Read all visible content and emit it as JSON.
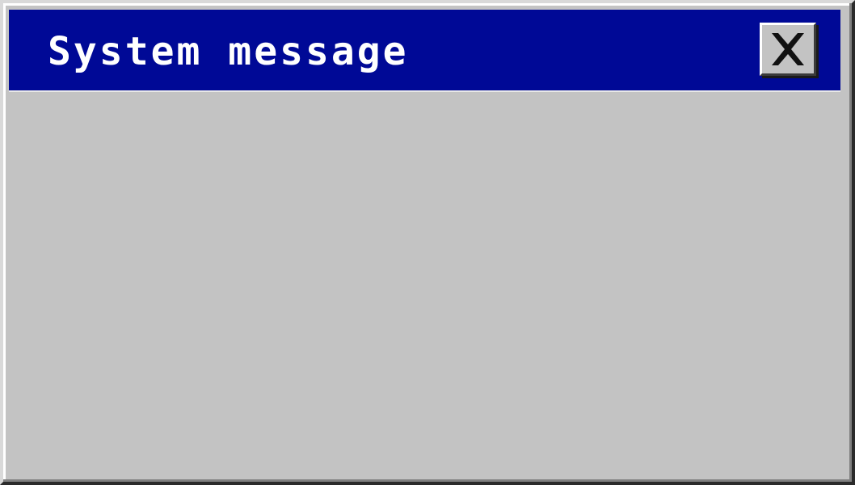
{
  "window": {
    "title": "System message"
  },
  "titlebar": {
    "close_icon": "close-icon"
  },
  "colors": {
    "titlebar": "#000996",
    "window_face": "#c3c3c3",
    "title_text": "#ffffff"
  }
}
